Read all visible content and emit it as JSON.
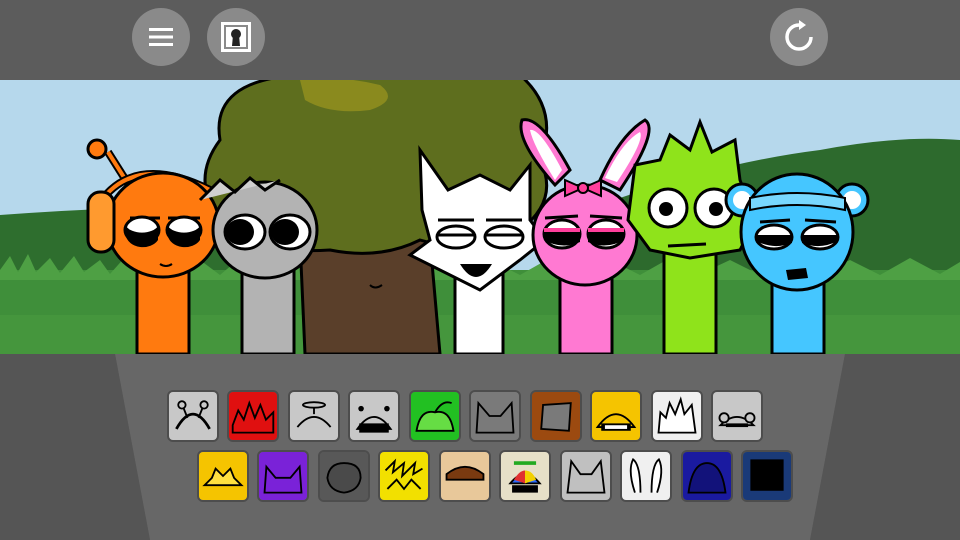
{
  "toolbar": {
    "menu_icon": "hamburger-icon",
    "keyhole_icon": "keyhole-icon",
    "reset_icon": "reset-icon"
  },
  "colors": {
    "toolbar": "#5c5c5c",
    "button": "#8a8a8a",
    "sky": "#b6d8ec",
    "grass": "#3f8f3a"
  },
  "characters": [
    {
      "name": "orange",
      "color": "#ff7a0f"
    },
    {
      "name": "gray",
      "color": "#b3b3b3"
    },
    {
      "name": "tree",
      "color": "#5a3f2a"
    },
    {
      "name": "white",
      "color": "#ffffff"
    },
    {
      "name": "pink",
      "color": "#ff79d2"
    },
    {
      "name": "lime",
      "color": "#8fe31b"
    },
    {
      "name": "sky-blue",
      "color": "#45c6ff"
    }
  ],
  "palette": {
    "row1": [
      {
        "icon": "antenna-headphones",
        "bg": "#c8c8c8"
      },
      {
        "icon": "red-spikes",
        "bg": "#e01010"
      },
      {
        "icon": "propeller-cap",
        "bg": "#c8c8c8"
      },
      {
        "icon": "black-box",
        "bg": "#c8c8c8"
      },
      {
        "icon": "green-leaf",
        "bg": "#22c022"
      },
      {
        "icon": "cat-ears",
        "bg": "#7a7a7a"
      },
      {
        "icon": "brown-bucket",
        "bg": "#9c4a10"
      },
      {
        "icon": "yellow-helmet",
        "bg": "#f5c400"
      },
      {
        "icon": "white-spikes",
        "bg": "#f0f0f0"
      },
      {
        "icon": "cloud-ears",
        "bg": "#c8c8c8"
      }
    ],
    "row2": [
      {
        "icon": "sun-crown",
        "bg": "#f5c400"
      },
      {
        "icon": "purple-horns",
        "bg": "#7a22d8"
      },
      {
        "icon": "dark-blob",
        "bg": "#585858"
      },
      {
        "icon": "lightning-hair",
        "bg": "#f2e000"
      },
      {
        "icon": "brown-hat",
        "bg": "#e8c89a"
      },
      {
        "icon": "beanie-propeller",
        "bg": "#e6e0c8"
      },
      {
        "icon": "gray-cat-ears",
        "bg": "#c0c0c0"
      },
      {
        "icon": "bunny-ears",
        "bg": "#f0f0f0"
      },
      {
        "icon": "navy-dome",
        "bg": "#1a1aa0"
      },
      {
        "icon": "black-top-hat",
        "bg": "#1a3a78"
      }
    ]
  }
}
